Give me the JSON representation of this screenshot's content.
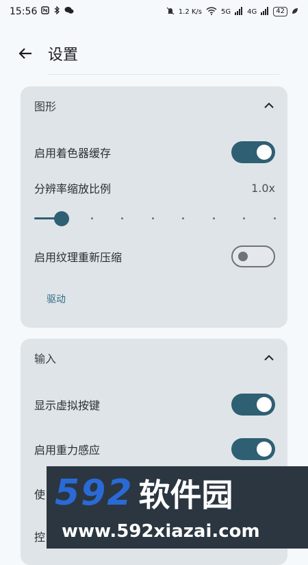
{
  "status_bar": {
    "time": "15:56",
    "speed": "1.2 K/s",
    "signal1": "5G",
    "signal2": "4G",
    "battery": "42"
  },
  "header": {
    "title": "设置"
  },
  "graphics": {
    "title": "图形",
    "shader_cache": {
      "label": "启用着色器缓存",
      "on": true
    },
    "resolution": {
      "label": "分辨率缩放比例",
      "value": "1.0x",
      "position": 0,
      "steps": 8
    },
    "texture_recompress": {
      "label": "启用纹理重新压缩",
      "on": false
    },
    "driver_button": "驱动"
  },
  "input": {
    "title": "输入",
    "virtual_keys": {
      "label": "显示虚拟按键",
      "on": true
    },
    "gravity": {
      "label": "启用重力感应",
      "on": true
    },
    "partial_row_1": "使",
    "partial_row_2": "控"
  },
  "watermark": {
    "logo_number": "592",
    "logo_text": "软件园",
    "url": "www.592xiazai.com"
  }
}
